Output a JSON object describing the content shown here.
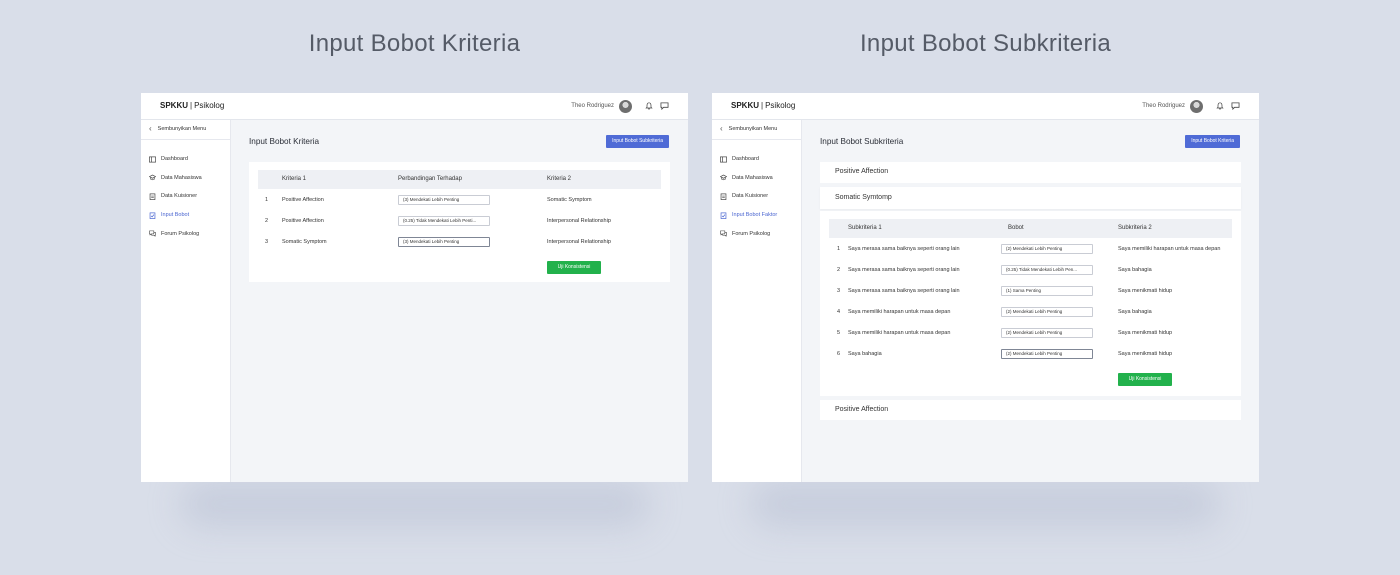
{
  "captions": {
    "left": "Input Bobot Kriteria",
    "right": "Input Bobot Subkriteria"
  },
  "app": {
    "brand": "SPKKU",
    "brand_sub": "Psikolog",
    "user": "Theo Rodriguez"
  },
  "sidebar": {
    "collapse_label": "Sembunyikan Menu",
    "items": [
      {
        "label": "Dashboard",
        "icon": "dashboard-icon"
      },
      {
        "label": "Data Mahasiswa",
        "icon": "students-icon"
      },
      {
        "label": "Data Kuisioner",
        "icon": "clipboard-icon"
      },
      {
        "label": "Input Bobot",
        "icon": "weight-icon"
      },
      {
        "label": "Forum Psikolog",
        "icon": "forum-icon"
      }
    ],
    "items_right": [
      {
        "label": "Dashboard"
      },
      {
        "label": "Data Mahasiswa"
      },
      {
        "label": "Data Kuisioner"
      },
      {
        "label": "Input Bobot Faktor"
      },
      {
        "label": "Forum Psikolog"
      }
    ]
  },
  "kriteria_page": {
    "title": "Input Bobot Kriteria",
    "button": "Input Bobot Subkriteria",
    "headers": [
      "Kriteria 1",
      "Perbandingan Terhadap",
      "Kriteria 2"
    ],
    "rows": [
      {
        "no": "1",
        "k1": "Positive Affection",
        "val": "(3) Mendekati Lebih Penting",
        "k2": "Somatic Symptom"
      },
      {
        "no": "2",
        "k1": "Positive Affection",
        "val": "(0.25) Tidak Mendekati Lebih Penti...",
        "k2": "Interpersonal Relationship"
      },
      {
        "no": "3",
        "k1": "Somatic Symptom",
        "val": "(3) Mendekati Lebih Penting",
        "k2": "Interpersonal Relationship"
      }
    ],
    "uji_button": "Uji Konsistensi"
  },
  "subkriteria_page": {
    "title": "Input Bobot Subkriteria",
    "button": "Input Bobot Kriteria",
    "accordion_1": "Positive Affection",
    "accordion_2": "Somatic Symtomp",
    "accordion_3": "Positive Affection",
    "headers": [
      "Subkriteria 1",
      "Bobot",
      "Subkriteria 2"
    ],
    "rows": [
      {
        "no": "1",
        "s1": "Saya merasa sama baiknya seperti orang lain",
        "val": "(2) Mendekati Lebih Penting",
        "s2": "Saya memiliki harapan untuk masa depan"
      },
      {
        "no": "2",
        "s1": "Saya merasa sama baiknya seperti orang lain",
        "val": "(0.25) Tidak Mendekati Lebih Pen...",
        "s2": "Saya bahagia"
      },
      {
        "no": "3",
        "s1": "Saya merasa sama baiknya seperti orang lain",
        "val": "(1) Sama Penting",
        "s2": "Saya menikmati hidup"
      },
      {
        "no": "4",
        "s1": "Saya memiliki harapan untuk masa depan",
        "val": "(2) Mendekati Lebih Penting",
        "s2": "Saya bahagia"
      },
      {
        "no": "5",
        "s1": "Saya memiliki harapan untuk masa depan",
        "val": "(2) Mendekati Lebih Penting",
        "s2": "Saya menikmati hidup"
      },
      {
        "no": "6",
        "s1": "Saya bahagia",
        "val": "(2) Mendekati Lebih Penting",
        "s2": "Saya menikmati hidup"
      }
    ],
    "uji_button": "Uji Konsistensi"
  }
}
